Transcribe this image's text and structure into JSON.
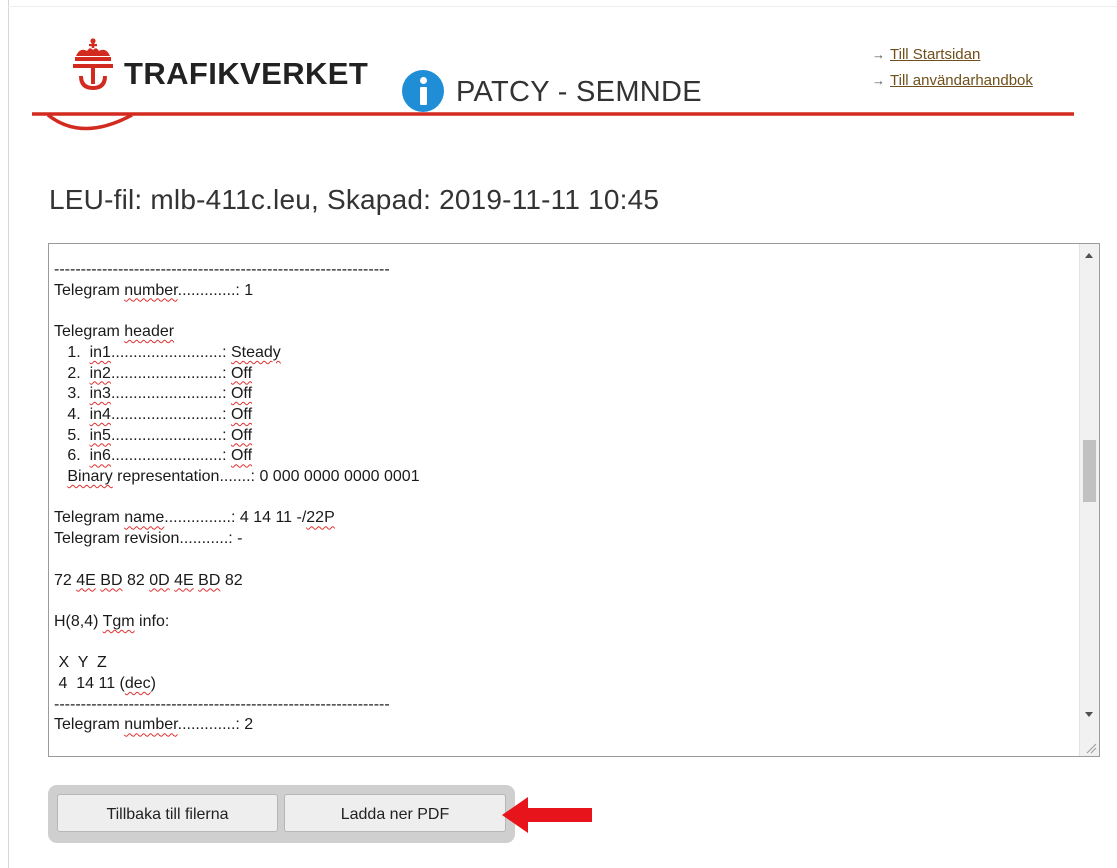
{
  "header": {
    "brand": "TRAFIKVERKET",
    "app_title": "PATCY - SEMNDE",
    "brand_color": "#d32a1f",
    "info_icon": "info-icon",
    "links": [
      {
        "arrow": "→",
        "label": "Till Startsidan"
      },
      {
        "arrow": "→",
        "label": "Till användarhandbok"
      }
    ]
  },
  "page_title": "LEU-fil: mlb-411c.leu, Skapad: 2019-11-11 10:45",
  "viewer": {
    "lines": [
      [
        {
          "t": "---------------------------------------------------------------"
        }
      ],
      [
        {
          "t": "Telegram "
        },
        {
          "t": "number",
          "sq": true
        },
        {
          "t": ".............: 1"
        }
      ],
      [
        {
          "t": ""
        }
      ],
      [
        {
          "t": "Telegram "
        },
        {
          "t": "header",
          "sq": true
        }
      ],
      [
        {
          "t": "   1.  "
        },
        {
          "t": "in1",
          "sq": true
        },
        {
          "t": ".........................: "
        },
        {
          "t": "Steady",
          "sq": true
        }
      ],
      [
        {
          "t": "   2.  "
        },
        {
          "t": "in2",
          "sq": true
        },
        {
          "t": ".........................: "
        },
        {
          "t": "Off",
          "sq": true
        }
      ],
      [
        {
          "t": "   3.  "
        },
        {
          "t": "in3",
          "sq": true
        },
        {
          "t": ".........................: "
        },
        {
          "t": "Off",
          "sq": true
        }
      ],
      [
        {
          "t": "   4.  "
        },
        {
          "t": "in4",
          "sq": true
        },
        {
          "t": ".........................: "
        },
        {
          "t": "Off",
          "sq": true
        }
      ],
      [
        {
          "t": "   5.  "
        },
        {
          "t": "in5",
          "sq": true
        },
        {
          "t": ".........................: "
        },
        {
          "t": "Off",
          "sq": true
        }
      ],
      [
        {
          "t": "   6.  "
        },
        {
          "t": "in6",
          "sq": true
        },
        {
          "t": ".........................: "
        },
        {
          "t": "Off",
          "sq": true
        }
      ],
      [
        {
          "t": "   "
        },
        {
          "t": "Binary",
          "sq": true
        },
        {
          "t": " representation.......: 0 000 0000 0000 0001"
        }
      ],
      [
        {
          "t": ""
        }
      ],
      [
        {
          "t": "Telegram "
        },
        {
          "t": "name",
          "sq": true
        },
        {
          "t": "...............: 4 14 11 -/"
        },
        {
          "t": "22P",
          "sq": true
        }
      ],
      [
        {
          "t": "Telegram revision...........: -"
        }
      ],
      [
        {
          "t": ""
        }
      ],
      [
        {
          "t": "72 "
        },
        {
          "t": "4E",
          "sq": true
        },
        {
          "t": " "
        },
        {
          "t": "BD",
          "sq": true
        },
        {
          "t": " 82 "
        },
        {
          "t": "0D",
          "sq": true
        },
        {
          "t": " "
        },
        {
          "t": "4E",
          "sq": true
        },
        {
          "t": " "
        },
        {
          "t": "BD",
          "sq": true
        },
        {
          "t": " 82"
        }
      ],
      [
        {
          "t": ""
        }
      ],
      [
        {
          "t": "H(8,4) "
        },
        {
          "t": "Tgm",
          "sq": true
        },
        {
          "t": " info:"
        }
      ],
      [
        {
          "t": ""
        }
      ],
      [
        {
          "t": " X  Y  Z"
        }
      ],
      [
        {
          "t": " 4  14 11 ("
        },
        {
          "t": "dec",
          "sq": true
        },
        {
          "t": ")"
        }
      ],
      [
        {
          "t": "---------------------------------------------------------------"
        }
      ],
      [
        {
          "t": "Telegram "
        },
        {
          "t": "number",
          "sq": true
        },
        {
          "t": ".............: 2"
        }
      ]
    ],
    "scroll_position": 0.35
  },
  "buttons": {
    "back": "Tillbaka till filerna",
    "pdf": "Ladda ner PDF"
  },
  "annotation_arrow_color": "#e8141b"
}
